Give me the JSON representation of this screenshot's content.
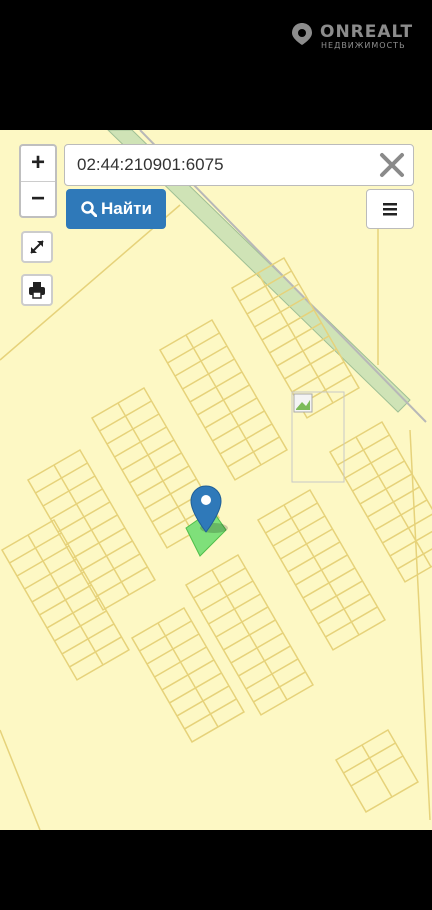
{
  "brand": {
    "name": "ONREALT",
    "tagline": "НЕДВИЖИМОСТЬ",
    "mark_icon": "onrealt-logo-icon"
  },
  "map": {
    "background_color": "#fdf8c4",
    "parcel_line_color": "#e6d27a",
    "road_color": "#cfe3b6",
    "selected_parcel_color": "#7fe07a",
    "marker_color": "#2f79b9"
  },
  "controls": {
    "zoom_in_label": "+",
    "zoom_out_label": "−",
    "fullscreen_icon": "expand-icon",
    "print_icon": "printer-icon",
    "menu_icon": "hamburger-icon"
  },
  "search": {
    "value": "02:44:210901:6075",
    "clear_icon": "close-icon",
    "button_label": "Найти",
    "button_icon": "search-icon"
  }
}
